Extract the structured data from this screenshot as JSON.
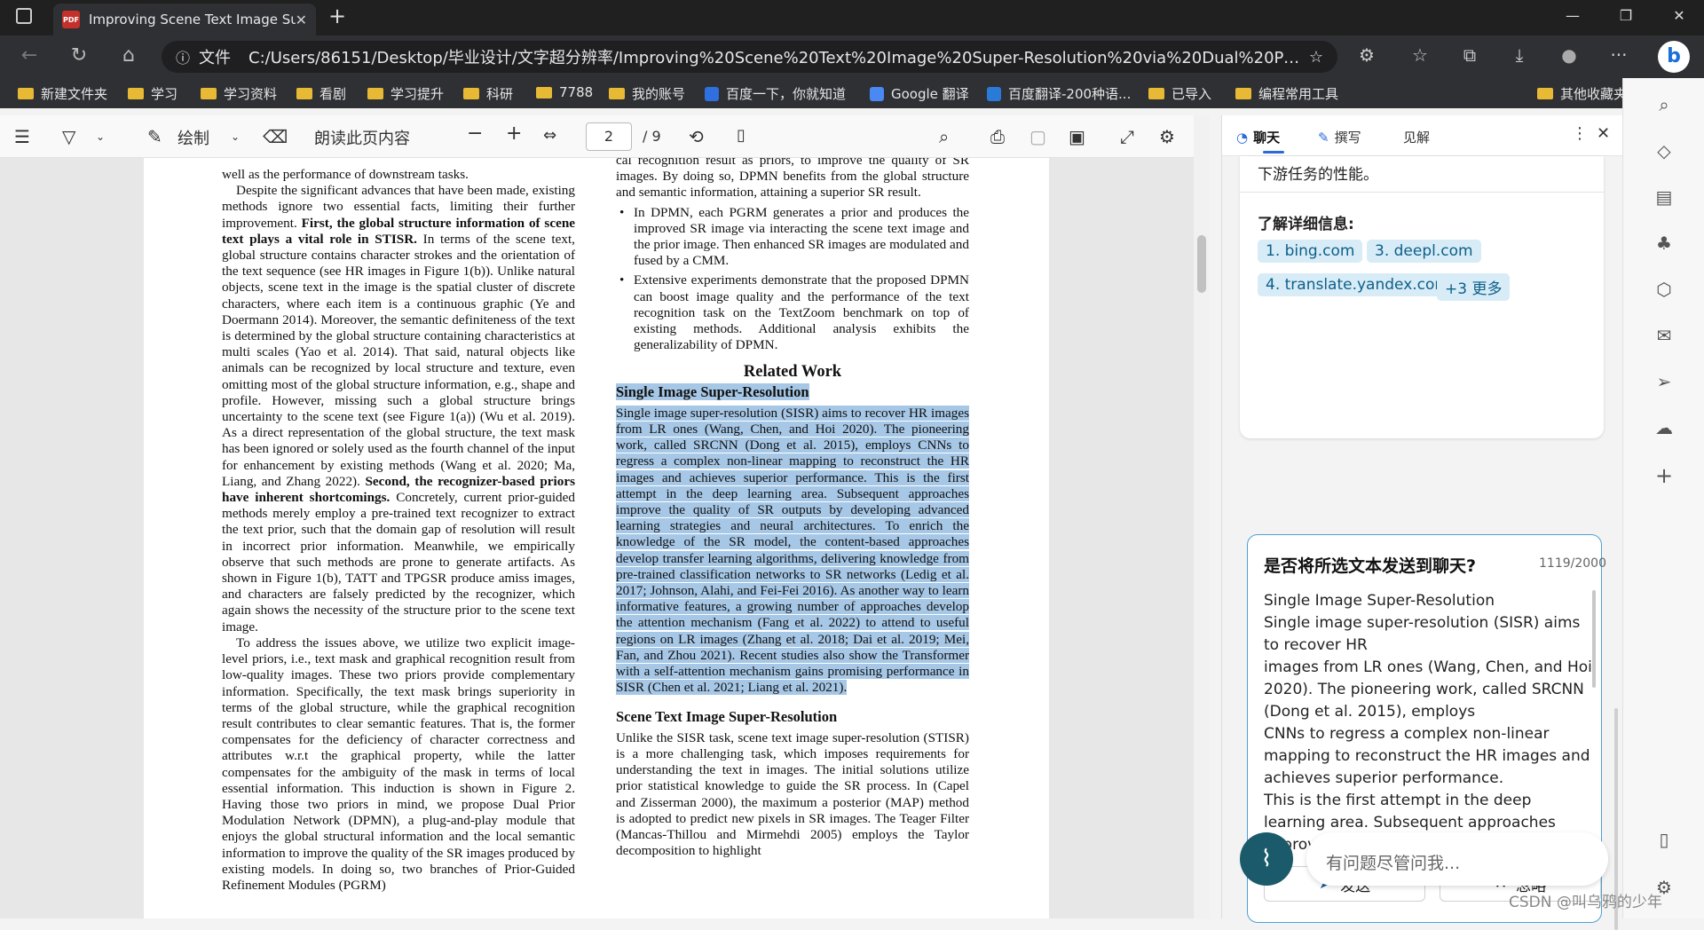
{
  "browser": {
    "tab_title": "Improving Scene Text Image Sup",
    "pdf_badge": "PDF",
    "address_prefix": "文件",
    "address": "C:/Users/86151/Desktop/毕业设计/文字超分辨率/Improving%20Scene%20Text%20Image%20Super-Resolution%20via%20Dual%20Prior%20Modula...",
    "bookmarks": [
      "新建文件夹",
      "学习",
      "学习资料",
      "看剧",
      "学习提升",
      "科研",
      "7788",
      "我的账号",
      "百度一下，你就知道",
      "Google 翻译",
      "百度翻译-200种语...",
      "已导入",
      "编程常用工具"
    ],
    "other_bookmarks": "其他收藏夹"
  },
  "pdf_toolbar": {
    "draw_label": "绘制",
    "read_aloud": "朗读此页内容",
    "page_current": "2",
    "page_total": "/ 9"
  },
  "left_column": [
    {
      "t": "well as the performance of downstream tasks.",
      "indent": false
    },
    {
      "t": "Despite the significant advances that have been made, existing methods ignore two essential facts, limiting their further improvement. ",
      "b": "First, the global structure information of scene text plays a vital role in STISR.",
      "t2": " In terms of the scene text, global structure contains character strokes and the orientation of the text sequence (see HR images in Figure 1(b)). Unlike natural objects, scene text in the image is the spatial cluster of discrete characters, where each item is a continuous graphic (Ye and Doermann 2014). Moreover, the semantic definiteness of the text is determined by the global structure containing characteristics at multi scales (Yao et al. 2014). That said, natural objects like animals can be recognized by local structure and texture, even omitting most of the global structure information, e.g., shape and profile. However, missing such a global structure brings uncertainty to the scene text (see Figure 1(a)) (Wu et al. 2019). As a direct representation of the global structure, the text mask has been ignored or solely used as the fourth channel of the input for enhancement by existing methods (Wang et al. 2020; Ma, Liang, and Zhang 2022). ",
      "b2": "Second, the recognizer-based priors have inherent shortcomings.",
      "t3": " Concretely, current prior-guided methods merely employ a pre-trained text recognizer to extract the text prior, such that the domain gap of resolution will result in incorrect prior information. Meanwhile, we empirically observe that such methods are prone to generate artifacts. As shown in Figure 1(b), TATT and TPGSR produce amiss images, and characters are falsely predicted by the recognizer, which again shows the necessity of the structure prior to the scene text image.",
      "indent": true
    },
    {
      "t": "To address the issues above, we utilize two explicit image-level priors, i.e., text mask and graphical recognition result from low-quality images. These two priors provide complementary information. Specifically, the text mask brings superiority in terms of the global structure, while the graphical recognition result contributes to clear semantic features. That is, the former compensates for the deficiency of character correctness and attributes w.r.t the graphical property, while the latter compensates for the ambiguity of the mask in terms of local essential information. This induction is shown in Figure 2. Having those two priors in mind, we propose Dual Prior Modulation Network (DPMN), a plug-and-play module that enjoys the global structural information and the local semantic information to improve the quality of the SR images produced by existing models. In doing so, two branches of Prior-Guided Refinement Modules (PGRM)",
      "indent": true
    }
  ],
  "right_column": {
    "cont": "cal recognition result as priors, to improve the quality of SR images. By doing so, DPMN benefits from the global structure and semantic information, attaining a superior SR result.",
    "bullets": [
      "In DPMN, each PGRM generates a prior and produces the improved SR image via interacting the scene text image and the prior image. Then enhanced SR images are modulated and fused by a CMM.",
      "Extensive experiments demonstrate that the proposed DPMN can boost image quality and the performance of the text recognition task on the TextZoom benchmark on top of existing methods. Additional analysis exhibits the generalizability of DPMN."
    ],
    "related_heading": "Related Work",
    "sisr_heading": "Single Image Super-Resolution",
    "sisr_text": "Single image super-resolution (SISR) aims to recover HR images from LR ones (Wang, Chen, and Hoi 2020). The pioneering work, called SRCNN (Dong et al. 2015), employs CNNs to regress a complex non-linear mapping to reconstruct the HR images and achieves superior performance. This is the first attempt in the deep learning area. Subsequent approaches improve the quality of SR outputs by developing advanced learning strategies and neural architectures. To enrich the knowledge of the SR model, the content-based approaches develop transfer learning algorithms, delivering knowledge from pre-trained classification networks to SR networks (Ledig et al. 2017; Johnson, Alahi, and Fei-Fei 2016). As another way to learn informative features, a growing number of approaches develop the attention mechanism (Fang et al. 2022) to attend to useful regions on LR images (Zhang et al. 2018; Dai et al. 2019; Mei, Fan, and Zhou 2021). Recent studies also show the Transformer with a self-attention mechanism gains promising performance in SISR (Chen et al. 2021; Liang et al. 2021).",
    "stisr_heading": "Scene Text Image Super-Resolution",
    "stisr_text": "Unlike the SISR task, scene text image super-resolution (STISR) is a more challenging task, which imposes requirements for understanding the text in images. The initial solutions utilize prior statistical knowledge to guide the SR process. In (Capel and Zisserman 2000), the maximum a posterior (MAP) method is adopted to predict new pixels in SR images. The Teager Filter (Mancas-Thillou and Mirmehdi 2005) employs the Taylor decomposition to highlight"
  },
  "sidebar": {
    "tabs": [
      "聊天",
      "撰写",
      "见解"
    ],
    "top_text": "下游任务的性能。",
    "learn_more": "了解详细信息:",
    "chips": [
      "1. bing.com",
      "3. deepl.com",
      "4. translate.yandex.com",
      "+3 更多"
    ],
    "prompt_title": "是否将所选文本发送到聊天?",
    "char_count": "1119/2000",
    "prompt_text": "Single Image Super-Resolution\nSingle image super-resolution (SISR) aims to recover HR\nimages from LR ones (Wang, Chen, and Hoi 2020). The pi\u0002oneering work, called SRCNN (Dong et al. 2015), employs\nCNNs to regress a complex non-linear mapping to recon\u0002struct the HR images and achieves superior performance.\nThis is the first attempt in the deep learning area. Subse\u0002quent approaches improve the quality of SR outputs by de\u0002veloping advanced",
    "send_label": "发送",
    "ignore_label": "忽略",
    "input_placeholder": "有问题尽管问我..."
  },
  "watermark": "CSDN @叫乌鸦的少年"
}
